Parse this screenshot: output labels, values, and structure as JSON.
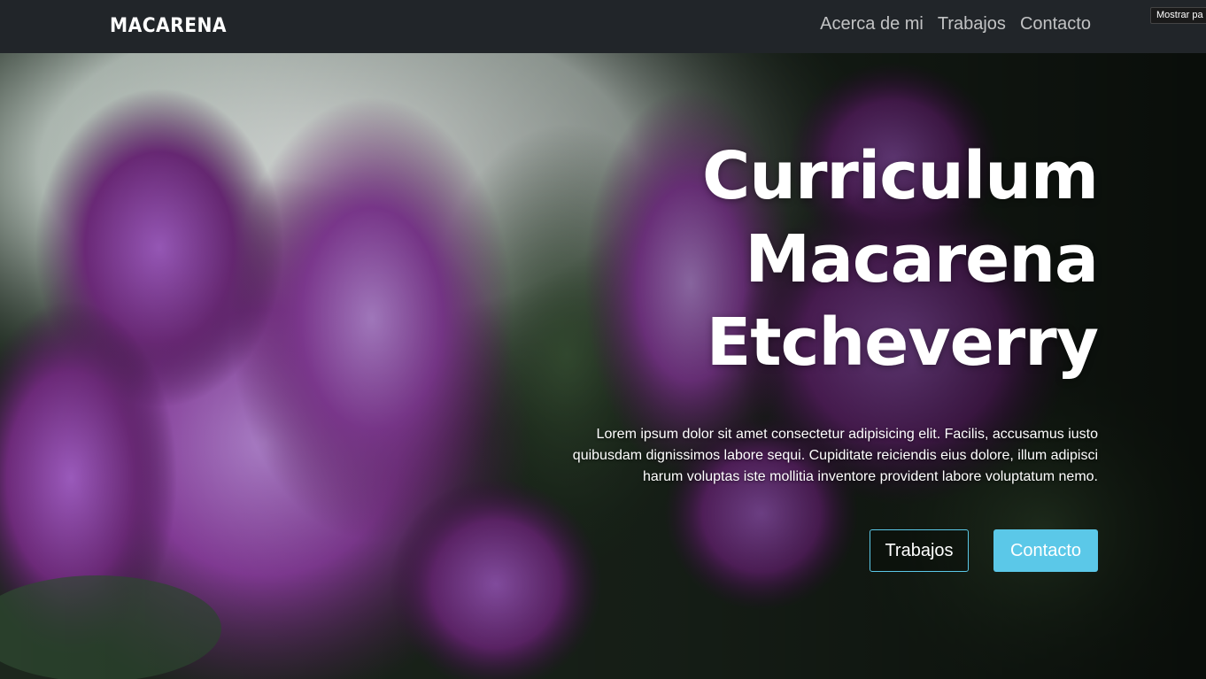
{
  "navbar": {
    "brand": "MACARENA",
    "links": [
      "Acerca de mi",
      "Trabajos",
      "Contacto"
    ],
    "overflow_button": "Mostrar pa"
  },
  "hero": {
    "title_lines": [
      "Curriculum",
      "Macarena",
      "Etcheverry"
    ],
    "text": "Lorem ipsum dolor sit amet consectetur adipisicing elit. Facilis, accusamus iusto quibusdam dignissimos labore sequi. Cupiditate reiciendis eius dolore, illum adipisci harum voluptas iste mollitia inventore provident labore voluptatum nemo.",
    "buttons": {
      "outline_label": "Trabajos",
      "solid_label": "Contacto"
    },
    "background_image": "lilac-flowers-photo"
  },
  "colors": {
    "navbar_bg": "#212529",
    "accent": "#5bc8e8",
    "text": "#ffffff"
  }
}
